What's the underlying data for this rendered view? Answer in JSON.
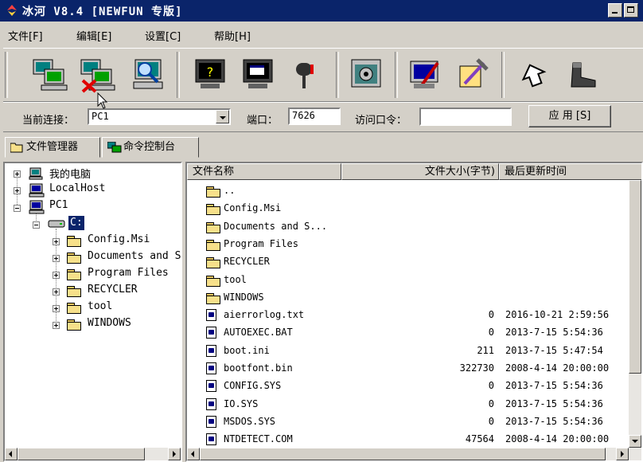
{
  "window": {
    "title": "冰河 V8.4 [NEWFUN 专版]"
  },
  "menu": {
    "items": [
      "文件[F]",
      "编辑[E]",
      "设置[C]",
      "帮助[H]"
    ]
  },
  "toolbar": {
    "buttons": [
      "computer-connect-icon",
      "computer-disconnect-icon",
      "computer-search-icon",
      "remote-help-icon",
      "remote-screen-icon",
      "mailbox-icon",
      "settings-image-icon",
      "notepad-edit-icon",
      "tools-icon",
      "send-message-icon",
      "boot-icon"
    ]
  },
  "connection": {
    "current_label": "当前连接：",
    "current_value": "PC1",
    "port_label": "端口：",
    "port_value": "7626",
    "password_label": "访问口令：",
    "password_value": "",
    "apply_label": "应 用 [S]"
  },
  "tabs": [
    {
      "label": "文件管理器"
    },
    {
      "label": "命令控制台"
    }
  ],
  "tree": {
    "nodes": [
      {
        "label": "我的电脑"
      },
      {
        "label": "LocalHost"
      },
      {
        "label": "PC1"
      },
      {
        "label": "C:"
      },
      {
        "label": "Config.Msi"
      },
      {
        "label": "Documents and S"
      },
      {
        "label": "Program Files"
      },
      {
        "label": "RECYCLER"
      },
      {
        "label": "tool"
      },
      {
        "label": "WINDOWS"
      }
    ]
  },
  "files": {
    "columns": {
      "name": "文件名称",
      "size": "文件大小(字节)",
      "date": "最后更新时间"
    },
    "rows": [
      {
        "name": "..",
        "size": "",
        "date": "",
        "kind": "folder"
      },
      {
        "name": "Config.Msi",
        "size": "",
        "date": "",
        "kind": "folder"
      },
      {
        "name": "Documents and S...",
        "size": "",
        "date": "",
        "kind": "folder"
      },
      {
        "name": "Program Files",
        "size": "",
        "date": "",
        "kind": "folder"
      },
      {
        "name": "RECYCLER",
        "size": "",
        "date": "",
        "kind": "folder"
      },
      {
        "name": "tool",
        "size": "",
        "date": "",
        "kind": "folder"
      },
      {
        "name": "WINDOWS",
        "size": "",
        "date": "",
        "kind": "folder"
      },
      {
        "name": "aierrorlog.txt",
        "size": "0",
        "date": "2016-10-21 2:59:56",
        "kind": "file"
      },
      {
        "name": "AUTOEXEC.BAT",
        "size": "0",
        "date": "2013-7-15 5:54:36",
        "kind": "file"
      },
      {
        "name": "boot.ini",
        "size": "211",
        "date": "2013-7-15 5:47:54",
        "kind": "file"
      },
      {
        "name": "bootfont.bin",
        "size": "322730",
        "date": "2008-4-14 20:00:00",
        "kind": "file"
      },
      {
        "name": "CONFIG.SYS",
        "size": "0",
        "date": "2013-7-15 5:54:36",
        "kind": "file"
      },
      {
        "name": "IO.SYS",
        "size": "0",
        "date": "2013-7-15 5:54:36",
        "kind": "file"
      },
      {
        "name": "MSDOS.SYS",
        "size": "0",
        "date": "2013-7-15 5:54:36",
        "kind": "file"
      },
      {
        "name": "NTDETECT.COM",
        "size": "47564",
        "date": "2008-4-14 20:00:00",
        "kind": "file"
      }
    ]
  },
  "colors": {
    "titlebar": "#0a246a",
    "face": "#d4d0c8",
    "selection": "#0a246a"
  }
}
